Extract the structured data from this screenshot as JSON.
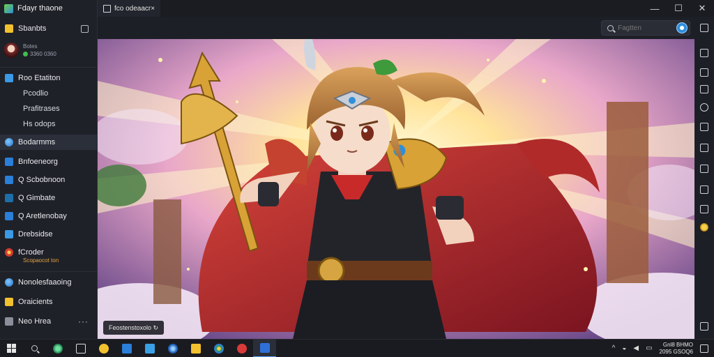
{
  "app": {
    "title": "Fdayr thaone"
  },
  "sidebar": {
    "header": {
      "label": "Sbanbts"
    },
    "profile": {
      "line1": "Botes",
      "line2": "3360 0360"
    },
    "items": [
      {
        "label": "Roo Etatiton",
        "sub": false
      },
      {
        "label": "Pcodlio",
        "sub": true
      },
      {
        "label": "Prafitrases",
        "sub": true
      },
      {
        "label": "Hs odops",
        "sub": true
      },
      {
        "label": "Bodarmms",
        "sub": false
      },
      {
        "label": "Bnfoeneorg",
        "sub": false
      },
      {
        "label": "Q  Scbobnoon",
        "sub": false
      },
      {
        "label": "Q  Gimbate",
        "sub": false
      },
      {
        "label": "Q  Aretlenobay",
        "sub": false
      },
      {
        "label": "Drebsidse",
        "sub": false
      },
      {
        "label": "fCroder",
        "sub": false
      },
      {
        "label": "Nonolesfaaoing",
        "sub": false
      },
      {
        "label": "Oraicients",
        "sub": false
      },
      {
        "label": "Neo Hrea",
        "sub": false
      }
    ],
    "orange_sub": "Scopaocot ton",
    "more": "···"
  },
  "tab": {
    "label": "fco odeaacr×"
  },
  "window": {
    "minimize": "—",
    "maximize": "☐",
    "close": "✕"
  },
  "search": {
    "placeholder": "Fagtten"
  },
  "caption": "Feostenstoxolo ↻",
  "taskbar": {
    "clock_line1": "Gnl8 BHMO",
    "clock_line2": "2095 GSOQ6"
  },
  "colors": {
    "sidebar_bg": "#1f2128",
    "accent": "#2a7fd8",
    "taskbar_bg": "#1a1b20"
  }
}
